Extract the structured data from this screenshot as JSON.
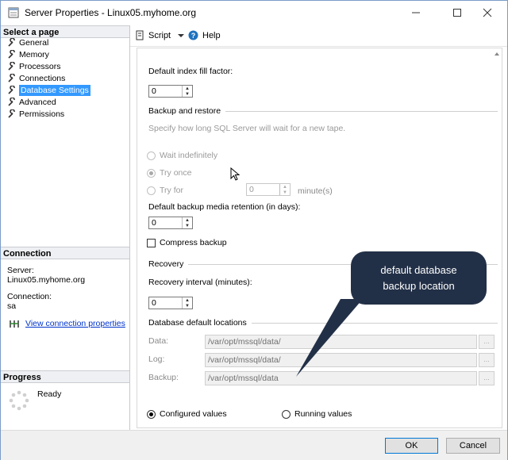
{
  "window": {
    "title": "Server Properties - Linux05.myhome.org",
    "controls": {
      "minimize": "minimize",
      "maximize": "maximize",
      "close": "close"
    }
  },
  "left": {
    "select_page_header": "Select a page",
    "pages": [
      {
        "label": "General"
      },
      {
        "label": "Memory"
      },
      {
        "label": "Processors"
      },
      {
        "label": "Connections"
      },
      {
        "label": "Database Settings"
      },
      {
        "label": "Advanced"
      },
      {
        "label": "Permissions"
      }
    ],
    "selected_page": "Database Settings",
    "connection_header": "Connection",
    "server_label": "Server:",
    "server_value": "Linux05.myhome.org",
    "connection_label": "Connection:",
    "connection_value": "sa",
    "view_link": "View connection properties",
    "progress_header": "Progress",
    "progress_status": "Ready"
  },
  "toolbar": {
    "script": "Script",
    "help": "Help"
  },
  "settings": {
    "fill_factor_label": "Default index fill factor:",
    "fill_factor_value": "0",
    "backup_group": "Backup and restore",
    "tape_hint": "Specify how long SQL Server will wait for a new tape.",
    "wait_indefinitely": "Wait indefinitely",
    "try_once": "Try once",
    "try_for": "Try for",
    "try_for_value": "0",
    "minutes_unit": "minute(s)",
    "retention_label": "Default backup media retention (in days):",
    "retention_value": "0",
    "compress_backup": "Compress backup",
    "recovery_group": "Recovery",
    "recovery_interval_label": "Recovery interval (minutes):",
    "recovery_interval_value": "0",
    "locations_group": "Database default locations",
    "data_label": "Data:",
    "data_path": "/var/opt/mssql/data/",
    "log_label": "Log:",
    "log_path": "/var/opt/mssql/data/",
    "backup_label": "Backup:",
    "backup_path": "/var/opt/mssql/data",
    "browse": "...",
    "configured_values": "Configured values",
    "running_values": "Running values"
  },
  "buttons": {
    "ok": "OK",
    "cancel": "Cancel"
  },
  "callout": {
    "line1": "default database",
    "line2": "backup location"
  },
  "colors": {
    "selection": "#3399ff",
    "callout": "#223047",
    "link": "#0033cc",
    "accent": "#0078d7"
  }
}
